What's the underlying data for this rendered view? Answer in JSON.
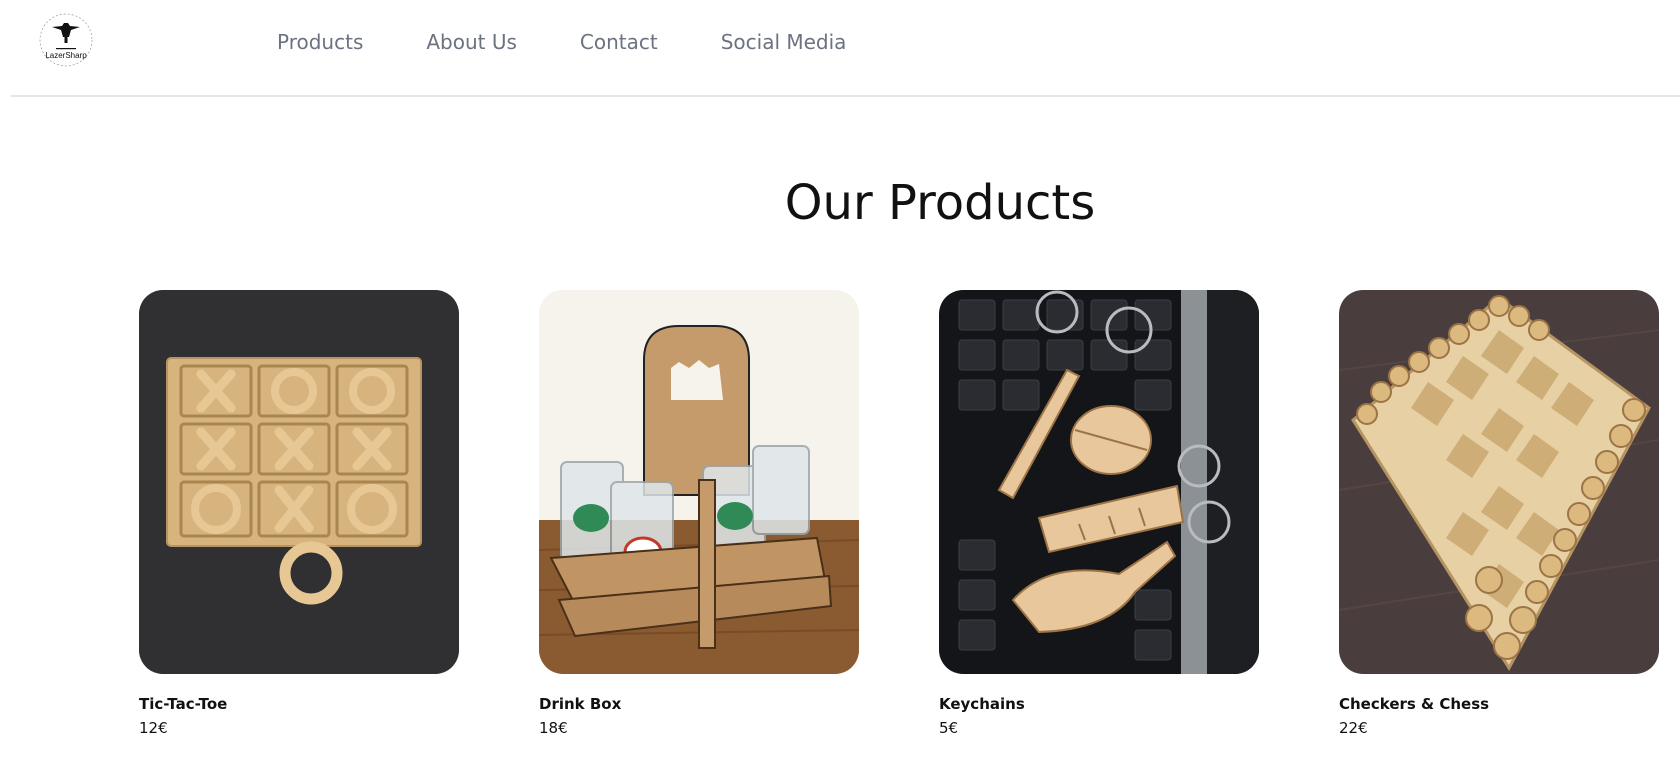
{
  "header": {
    "logo_text": "LazerSharp",
    "nav": [
      {
        "label": "Products"
      },
      {
        "label": "About Us"
      },
      {
        "label": "Contact"
      },
      {
        "label": "Social Media"
      }
    ]
  },
  "main": {
    "title": "Our Products",
    "products": [
      {
        "name": "Tic-Tac-Toe",
        "price": "12€"
      },
      {
        "name": "Drink Box",
        "price": "18€"
      },
      {
        "name": "Keychains",
        "price": "5€"
      },
      {
        "name": "Checkers & Chess",
        "price": "22€"
      }
    ]
  },
  "colors": {
    "nav_text": "#6b7280",
    "divider": "#e6e6e6",
    "wood": "#d8b98a"
  }
}
